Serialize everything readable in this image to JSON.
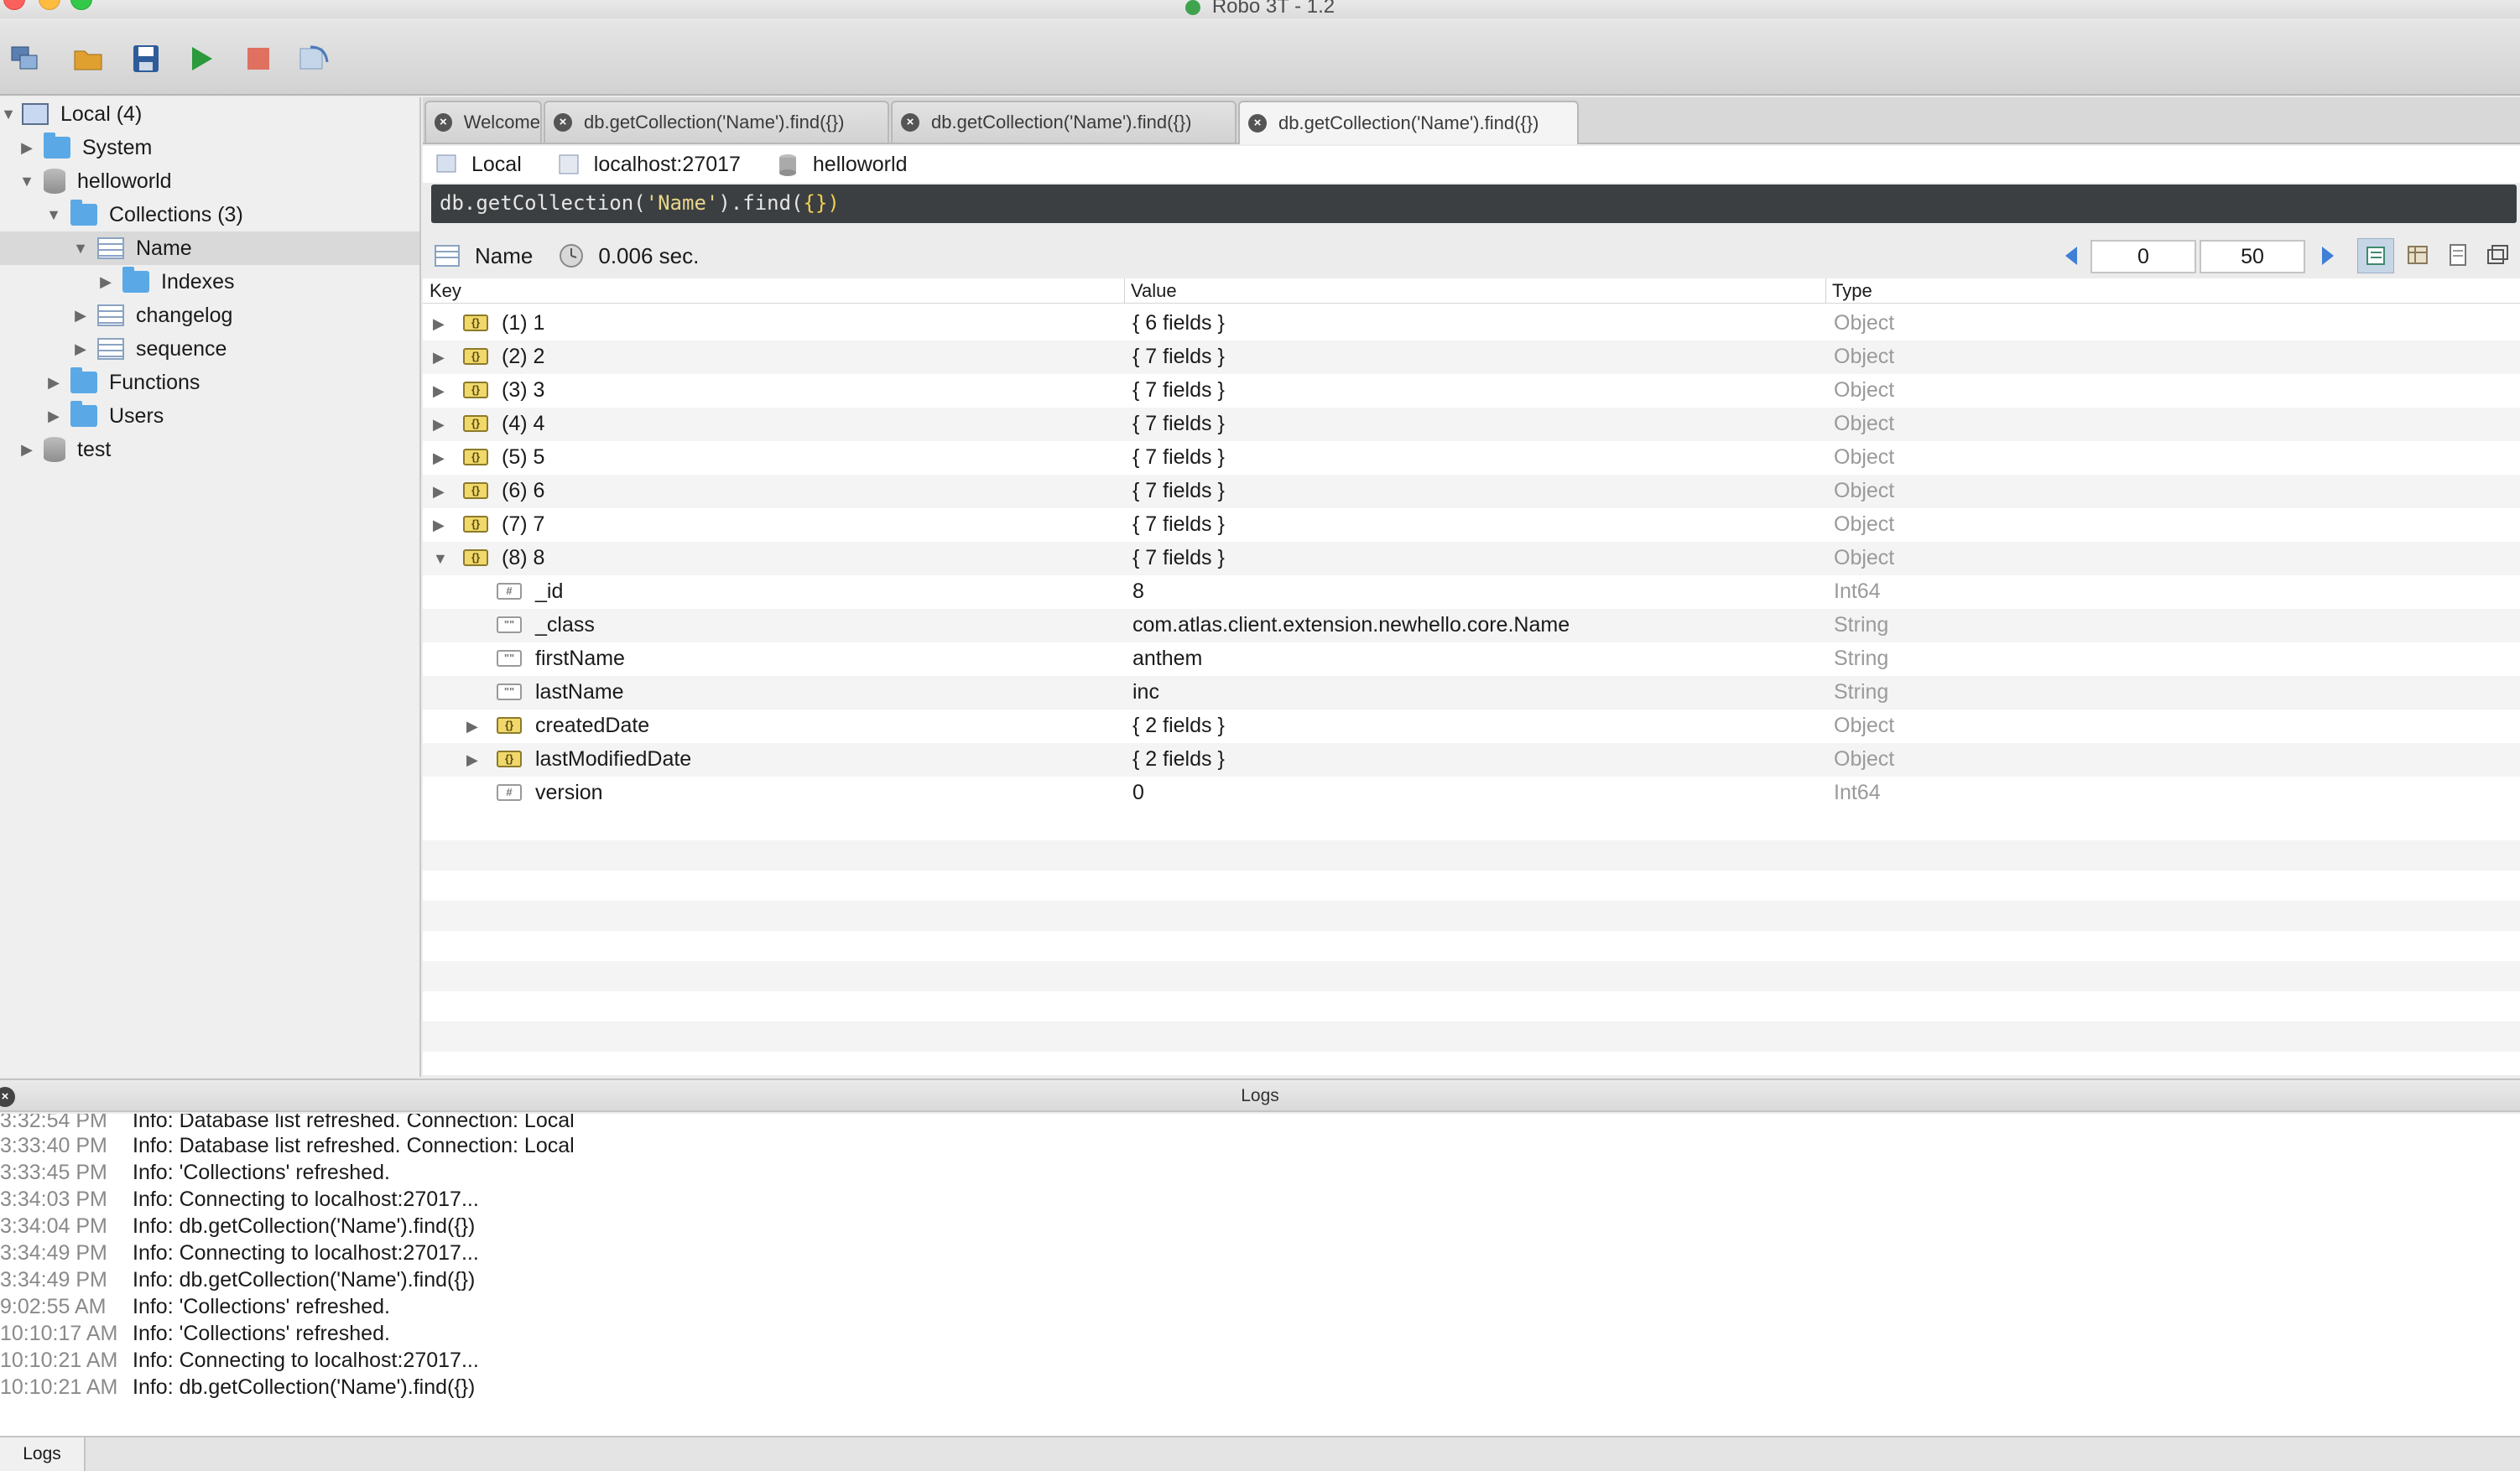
{
  "window": {
    "title": "Robo 3T - 1.2"
  },
  "tree": {
    "items": [
      {
        "label": "Local (4)"
      },
      {
        "label": "System"
      },
      {
        "label": "helloworld"
      },
      {
        "label": "Collections (3)"
      },
      {
        "label": "Name"
      },
      {
        "label": "Indexes"
      },
      {
        "label": "changelog"
      },
      {
        "label": "sequence"
      },
      {
        "label": "Functions"
      },
      {
        "label": "Users"
      },
      {
        "label": "test"
      }
    ]
  },
  "tabs": [
    {
      "label": "Welcome"
    },
    {
      "label": "db.getCollection('Name').find({})"
    },
    {
      "label": "db.getCollection('Name').find({})"
    },
    {
      "label": "db.getCollection('Name').find({})"
    }
  ],
  "connection": {
    "server": "Local",
    "host": "localhost:27017",
    "database": "helloworld"
  },
  "query": {
    "prefix": "db.getCollection(",
    "collection": "'Name'",
    "middle": ").find(",
    "arg": "{}",
    "suffix": ")"
  },
  "results_bar": {
    "collection": "Name",
    "time": "0.006 sec.",
    "skip": "0",
    "limit": "50"
  },
  "columns": {
    "key": "Key",
    "value": "Value",
    "type": "Type"
  },
  "rows": [
    {
      "key": "(1) 1",
      "value": "{ 6 fields }",
      "type": "Object"
    },
    {
      "key": "(2) 2",
      "value": "{ 7 fields }",
      "type": "Object"
    },
    {
      "key": "(3) 3",
      "value": "{ 7 fields }",
      "type": "Object"
    },
    {
      "key": "(4) 4",
      "value": "{ 7 fields }",
      "type": "Object"
    },
    {
      "key": "(5) 5",
      "value": "{ 7 fields }",
      "type": "Object"
    },
    {
      "key": "(6) 6",
      "value": "{ 7 fields }",
      "type": "Object"
    },
    {
      "key": "(7) 7",
      "value": "{ 7 fields }",
      "type": "Object"
    },
    {
      "key": "(8) 8",
      "value": "{ 7 fields }",
      "type": "Object"
    },
    {
      "key": "_id",
      "value": "8",
      "type": "Int64"
    },
    {
      "key": "_class",
      "value": "com.atlas.client.extension.newhello.core.Name",
      "type": "String"
    },
    {
      "key": "firstName",
      "value": "anthem",
      "type": "String"
    },
    {
      "key": "lastName",
      "value": "inc",
      "type": "String"
    },
    {
      "key": "createdDate",
      "value": "{ 2 fields }",
      "type": "Object"
    },
    {
      "key": "lastModifiedDate",
      "value": "{ 2 fields }",
      "type": "Object"
    },
    {
      "key": "version",
      "value": "0",
      "type": "Int64"
    }
  ],
  "logs": {
    "title": "Logs",
    "tab": "Logs",
    "lines": [
      {
        "time": "3:32:54 PM",
        "msg": "Info: Database list refreshed. Connection: Local"
      },
      {
        "time": "3:33:40 PM",
        "msg": "Info: Database list refreshed. Connection: Local"
      },
      {
        "time": "3:33:45 PM",
        "msg": "Info: 'Collections' refreshed."
      },
      {
        "time": "3:34:03 PM",
        "msg": "Info: Connecting to localhost:27017..."
      },
      {
        "time": "3:34:04 PM",
        "msg": "Info: db.getCollection('Name').find({})"
      },
      {
        "time": "3:34:49 PM",
        "msg": "Info: Connecting to localhost:27017..."
      },
      {
        "time": "3:34:49 PM",
        "msg": "Info: db.getCollection('Name').find({})"
      },
      {
        "time": "9:02:55 AM",
        "msg": "Info: 'Collections' refreshed."
      },
      {
        "time": "10:10:17 AM",
        "msg": "Info: 'Collections' refreshed."
      },
      {
        "time": "10:10:21 AM",
        "msg": "Info: Connecting to localhost:27017..."
      },
      {
        "time": "10:10:21 AM",
        "msg": "Info: db.getCollection('Name').find({})"
      }
    ]
  }
}
